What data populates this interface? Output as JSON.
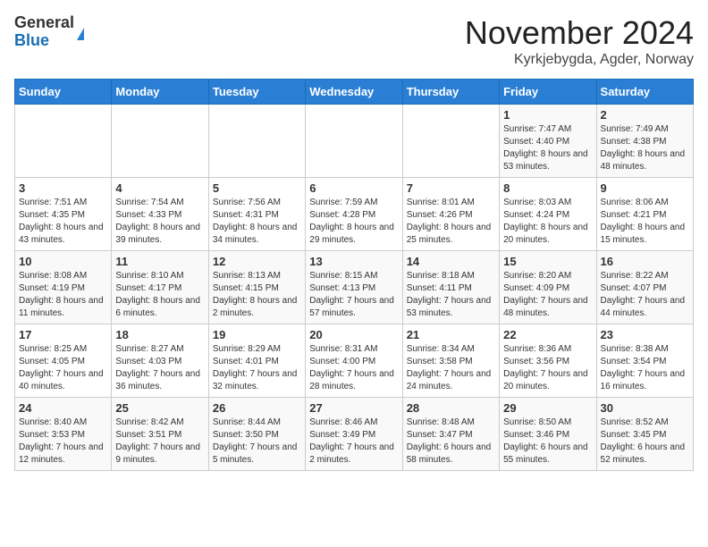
{
  "logo": {
    "general": "General",
    "blue": "Blue"
  },
  "header": {
    "month": "November 2024",
    "location": "Kyrkjebygda, Agder, Norway"
  },
  "weekdays": [
    "Sunday",
    "Monday",
    "Tuesday",
    "Wednesday",
    "Thursday",
    "Friday",
    "Saturday"
  ],
  "weeks": [
    [
      {
        "day": "",
        "info": ""
      },
      {
        "day": "",
        "info": ""
      },
      {
        "day": "",
        "info": ""
      },
      {
        "day": "",
        "info": ""
      },
      {
        "day": "",
        "info": ""
      },
      {
        "day": "1",
        "info": "Sunrise: 7:47 AM\nSunset: 4:40 PM\nDaylight: 8 hours and 53 minutes."
      },
      {
        "day": "2",
        "info": "Sunrise: 7:49 AM\nSunset: 4:38 PM\nDaylight: 8 hours and 48 minutes."
      }
    ],
    [
      {
        "day": "3",
        "info": "Sunrise: 7:51 AM\nSunset: 4:35 PM\nDaylight: 8 hours and 43 minutes."
      },
      {
        "day": "4",
        "info": "Sunrise: 7:54 AM\nSunset: 4:33 PM\nDaylight: 8 hours and 39 minutes."
      },
      {
        "day": "5",
        "info": "Sunrise: 7:56 AM\nSunset: 4:31 PM\nDaylight: 8 hours and 34 minutes."
      },
      {
        "day": "6",
        "info": "Sunrise: 7:59 AM\nSunset: 4:28 PM\nDaylight: 8 hours and 29 minutes."
      },
      {
        "day": "7",
        "info": "Sunrise: 8:01 AM\nSunset: 4:26 PM\nDaylight: 8 hours and 25 minutes."
      },
      {
        "day": "8",
        "info": "Sunrise: 8:03 AM\nSunset: 4:24 PM\nDaylight: 8 hours and 20 minutes."
      },
      {
        "day": "9",
        "info": "Sunrise: 8:06 AM\nSunset: 4:21 PM\nDaylight: 8 hours and 15 minutes."
      }
    ],
    [
      {
        "day": "10",
        "info": "Sunrise: 8:08 AM\nSunset: 4:19 PM\nDaylight: 8 hours and 11 minutes."
      },
      {
        "day": "11",
        "info": "Sunrise: 8:10 AM\nSunset: 4:17 PM\nDaylight: 8 hours and 6 minutes."
      },
      {
        "day": "12",
        "info": "Sunrise: 8:13 AM\nSunset: 4:15 PM\nDaylight: 8 hours and 2 minutes."
      },
      {
        "day": "13",
        "info": "Sunrise: 8:15 AM\nSunset: 4:13 PM\nDaylight: 7 hours and 57 minutes."
      },
      {
        "day": "14",
        "info": "Sunrise: 8:18 AM\nSunset: 4:11 PM\nDaylight: 7 hours and 53 minutes."
      },
      {
        "day": "15",
        "info": "Sunrise: 8:20 AM\nSunset: 4:09 PM\nDaylight: 7 hours and 48 minutes."
      },
      {
        "day": "16",
        "info": "Sunrise: 8:22 AM\nSunset: 4:07 PM\nDaylight: 7 hours and 44 minutes."
      }
    ],
    [
      {
        "day": "17",
        "info": "Sunrise: 8:25 AM\nSunset: 4:05 PM\nDaylight: 7 hours and 40 minutes."
      },
      {
        "day": "18",
        "info": "Sunrise: 8:27 AM\nSunset: 4:03 PM\nDaylight: 7 hours and 36 minutes."
      },
      {
        "day": "19",
        "info": "Sunrise: 8:29 AM\nSunset: 4:01 PM\nDaylight: 7 hours and 32 minutes."
      },
      {
        "day": "20",
        "info": "Sunrise: 8:31 AM\nSunset: 4:00 PM\nDaylight: 7 hours and 28 minutes."
      },
      {
        "day": "21",
        "info": "Sunrise: 8:34 AM\nSunset: 3:58 PM\nDaylight: 7 hours and 24 minutes."
      },
      {
        "day": "22",
        "info": "Sunrise: 8:36 AM\nSunset: 3:56 PM\nDaylight: 7 hours and 20 minutes."
      },
      {
        "day": "23",
        "info": "Sunrise: 8:38 AM\nSunset: 3:54 PM\nDaylight: 7 hours and 16 minutes."
      }
    ],
    [
      {
        "day": "24",
        "info": "Sunrise: 8:40 AM\nSunset: 3:53 PM\nDaylight: 7 hours and 12 minutes."
      },
      {
        "day": "25",
        "info": "Sunrise: 8:42 AM\nSunset: 3:51 PM\nDaylight: 7 hours and 9 minutes."
      },
      {
        "day": "26",
        "info": "Sunrise: 8:44 AM\nSunset: 3:50 PM\nDaylight: 7 hours and 5 minutes."
      },
      {
        "day": "27",
        "info": "Sunrise: 8:46 AM\nSunset: 3:49 PM\nDaylight: 7 hours and 2 minutes."
      },
      {
        "day": "28",
        "info": "Sunrise: 8:48 AM\nSunset: 3:47 PM\nDaylight: 6 hours and 58 minutes."
      },
      {
        "day": "29",
        "info": "Sunrise: 8:50 AM\nSunset: 3:46 PM\nDaylight: 6 hours and 55 minutes."
      },
      {
        "day": "30",
        "info": "Sunrise: 8:52 AM\nSunset: 3:45 PM\nDaylight: 6 hours and 52 minutes."
      }
    ]
  ]
}
